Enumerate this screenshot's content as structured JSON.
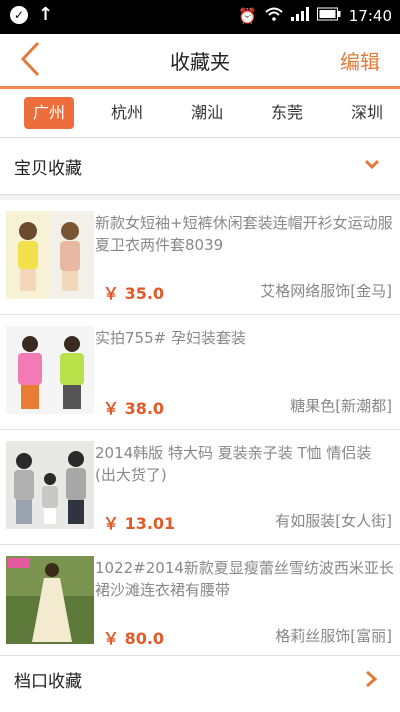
{
  "status_bar": {
    "time": "17:40"
  },
  "header": {
    "title": "收藏夹",
    "edit_label": "编辑"
  },
  "tabs": [
    {
      "label": "广州",
      "active": true
    },
    {
      "label": "杭州",
      "active": false
    },
    {
      "label": "潮汕",
      "active": false
    },
    {
      "label": "东莞",
      "active": false
    },
    {
      "label": "深圳",
      "active": false
    }
  ],
  "sections": {
    "products": "宝贝收藏",
    "stalls": "档口收藏"
  },
  "items": [
    {
      "title": "新款女短袖+短裤休闲套装连帽开衫女运动服夏卫衣两件套8039",
      "price": "￥ 35.0",
      "shop": "艾格网络服饰[金马]"
    },
    {
      "title": "实拍755#  孕妇装套装",
      "price": "￥ 38.0",
      "shop": "糖果色[新潮都]"
    },
    {
      "title": "2014韩版 特大码 夏装亲子装 T恤  情侣装 (出大货了)",
      "price": "￥ 13.01",
      "shop": "有如服装[女人街]"
    },
    {
      "title": "1022#2014新款夏显瘦蕾丝雪纺波西米亚长裙沙滩连衣裙有腰带",
      "price": "￥ 80.0",
      "shop": "格莉丝服饰[富丽]"
    }
  ],
  "colors": {
    "accent": "#ee6d3c",
    "price": "#e05a2a",
    "edit": "#e27b3a"
  }
}
